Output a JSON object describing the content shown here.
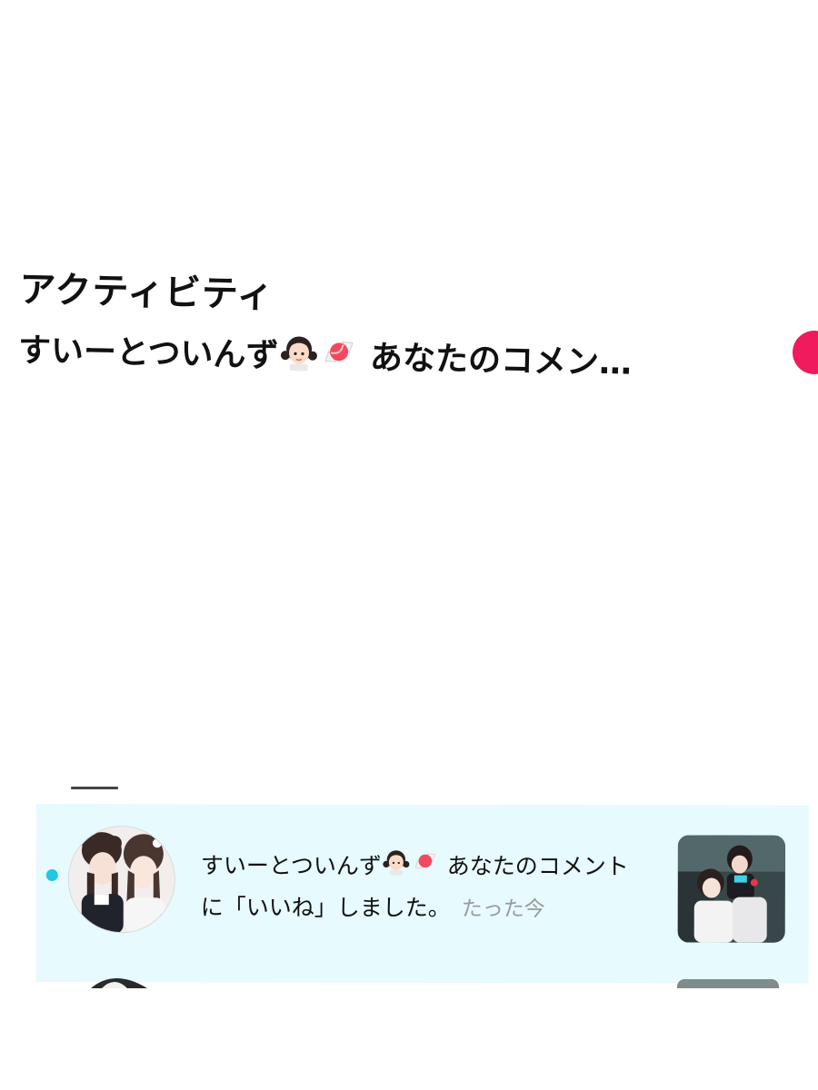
{
  "banner": {
    "title": "アクティビティ",
    "sender": "すいーとついんず",
    "message_preview": "あなたのコメン…",
    "icons": [
      "girl-emoji",
      "candy-emoji"
    ],
    "accent_color": "#f01b5c"
  },
  "notification": {
    "sender": "すいーとついんず",
    "message": "あなたのコメントに「いいね」しました。",
    "time": "たった今",
    "unread": true,
    "background_color": "#e7fafd",
    "unread_color": "#1ec8e6",
    "icons": [
      "girl-emoji",
      "candy-emoji"
    ]
  }
}
